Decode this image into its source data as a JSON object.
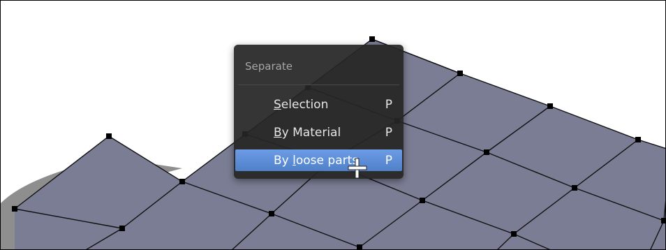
{
  "menu": {
    "title": "Separate",
    "items": [
      {
        "pre": "",
        "key": "S",
        "post": "election",
        "shortcut": "P",
        "active": false
      },
      {
        "pre": "",
        "key": "B",
        "post": "y Material",
        "shortcut": "P",
        "active": false
      },
      {
        "pre": "By ",
        "key": "l",
        "post": "oose parts",
        "shortcut": "P",
        "active": true
      }
    ]
  },
  "colors": {
    "mesh_face": "#7b7d94",
    "mesh_edge": "#111111",
    "menu_background": "#262626",
    "menu_highlight": "#5a8bd6"
  },
  "icons": {
    "cursor": "move-cursor-icon"
  }
}
